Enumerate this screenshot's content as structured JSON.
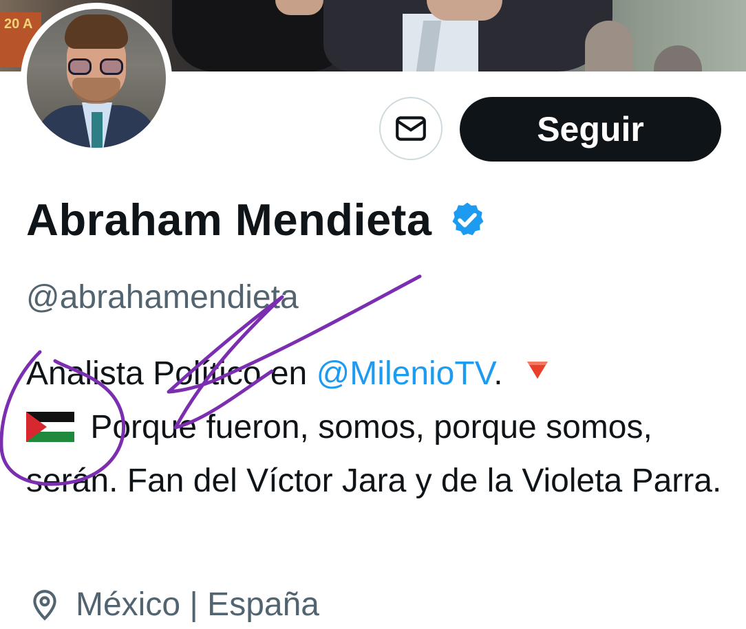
{
  "header": {
    "follow_label": "Seguir",
    "message_icon": "envelope-icon"
  },
  "profile": {
    "name": "Abraham Mendieta",
    "verified_icon": "verified-badge-icon",
    "handle": "@abrahamendieta",
    "bio": {
      "part1": "Analista Político en ",
      "mention": "@MilenioTV",
      "part2": ".",
      "emoji1": "red-triangle-icon",
      "emoji2": "palestine-flag-icon",
      "part3": " Porque fueron, somos, porque somos, serán. Fan del Víctor Jara y de la Violeta Parra."
    },
    "location": "México | España",
    "location_icon": "location-pin-icon"
  },
  "colors": {
    "follow_bg": "#0f1419",
    "mention": "#1d9bf0",
    "secondary_text": "#536471",
    "verified": "#1d9bf0",
    "annotation_stroke": "#7b2fb0"
  }
}
